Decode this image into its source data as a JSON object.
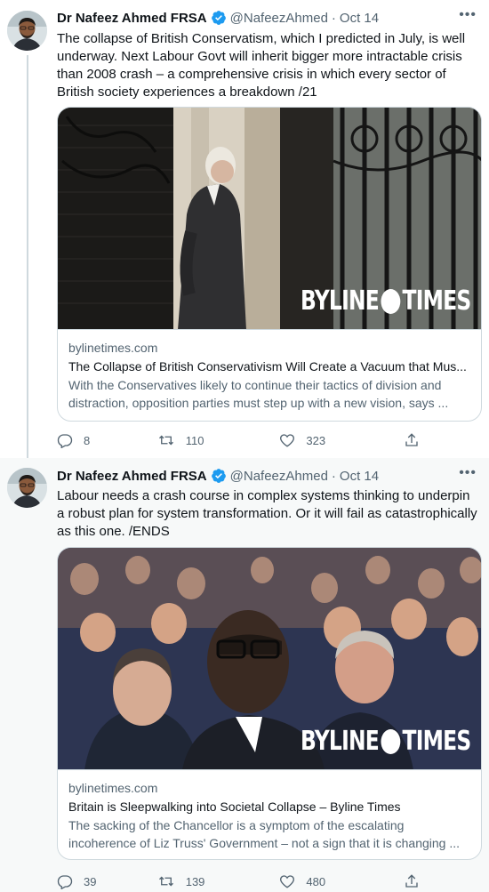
{
  "tweets": [
    {
      "author_name": "Dr Nafeez Ahmed FRSA",
      "handle": "@NafeezAhmed",
      "separator": "·",
      "date": "Oct 14",
      "text": "The collapse of British Conservatism, which I predicted in July, is well underway. Next Labour Govt will inherit bigger more intractable crisis than 2008 crash – a comprehensive crisis in which every sector of British society experiences a breakdown /21",
      "card": {
        "logo_left": "BYLINE",
        "logo_right": "TIMES",
        "domain": "bylinetimes.com",
        "title": "The Collapse of British Conservativism Will Create a Vacuum that Mus...",
        "description": "With the Conservatives likely to continue their tactics of division and distraction, opposition parties must step up with a new vision, says ..."
      },
      "replies": "8",
      "retweets": "110",
      "likes": "323"
    },
    {
      "author_name": "Dr Nafeez Ahmed FRSA",
      "handle": "@NafeezAhmed",
      "separator": "·",
      "date": "Oct 14",
      "text": "Labour needs a crash course in complex systems thinking to underpin a robust plan for system transformation. Or it will fail as catastrophically as this one. /ENDS",
      "card": {
        "logo_left": "BYLINE",
        "logo_right": "TIMES",
        "domain": "bylinetimes.com",
        "title": "Britain is Sleepwalking into Societal Collapse – Byline Times",
        "description": "The sacking of the Chancellor is a symptom of the escalating incoherence of Liz Truss' Government – not a sign that it is changing ..."
      },
      "replies": "39",
      "retweets": "139",
      "likes": "480"
    }
  ],
  "colors": {
    "text_primary": "#0f1419",
    "text_secondary": "#536471",
    "verified_blue": "#1d9bf0",
    "border": "#cfd9de",
    "selected_bg": "#f7f9f9"
  },
  "icons": [
    "verified-badge-icon",
    "more-icon",
    "reply-icon",
    "retweet-icon",
    "like-icon",
    "share-icon"
  ]
}
